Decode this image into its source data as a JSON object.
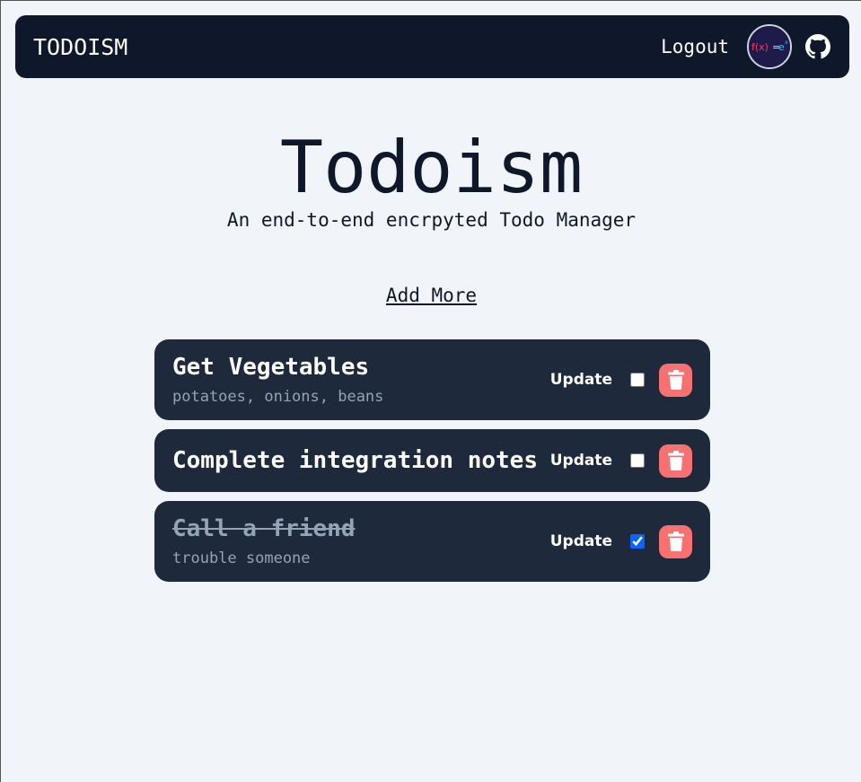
{
  "navbar": {
    "brand": "TODOISM",
    "logout_label": "Logout",
    "avatar_icon": "avatar-fx-icon",
    "github_icon": "github-icon"
  },
  "hero": {
    "title": "Todoism",
    "subtitle": "An end-to-end encrpyted Todo Manager"
  },
  "add_more_label": "Add More",
  "todos": [
    {
      "title": "Get Vegetables",
      "description": "potatoes, onions, beans",
      "completed": false,
      "update_label": "Update"
    },
    {
      "title": "Complete integration notes",
      "description": "",
      "completed": false,
      "update_label": "Update"
    },
    {
      "title": "Call a friend",
      "description": "trouble someone",
      "completed": true,
      "update_label": "Update"
    }
  ],
  "colors": {
    "background": "#f1f5f9",
    "navbar": "#0f172a",
    "card": "#1e293b",
    "delete": "#f87171",
    "muted": "#94a3b8"
  }
}
